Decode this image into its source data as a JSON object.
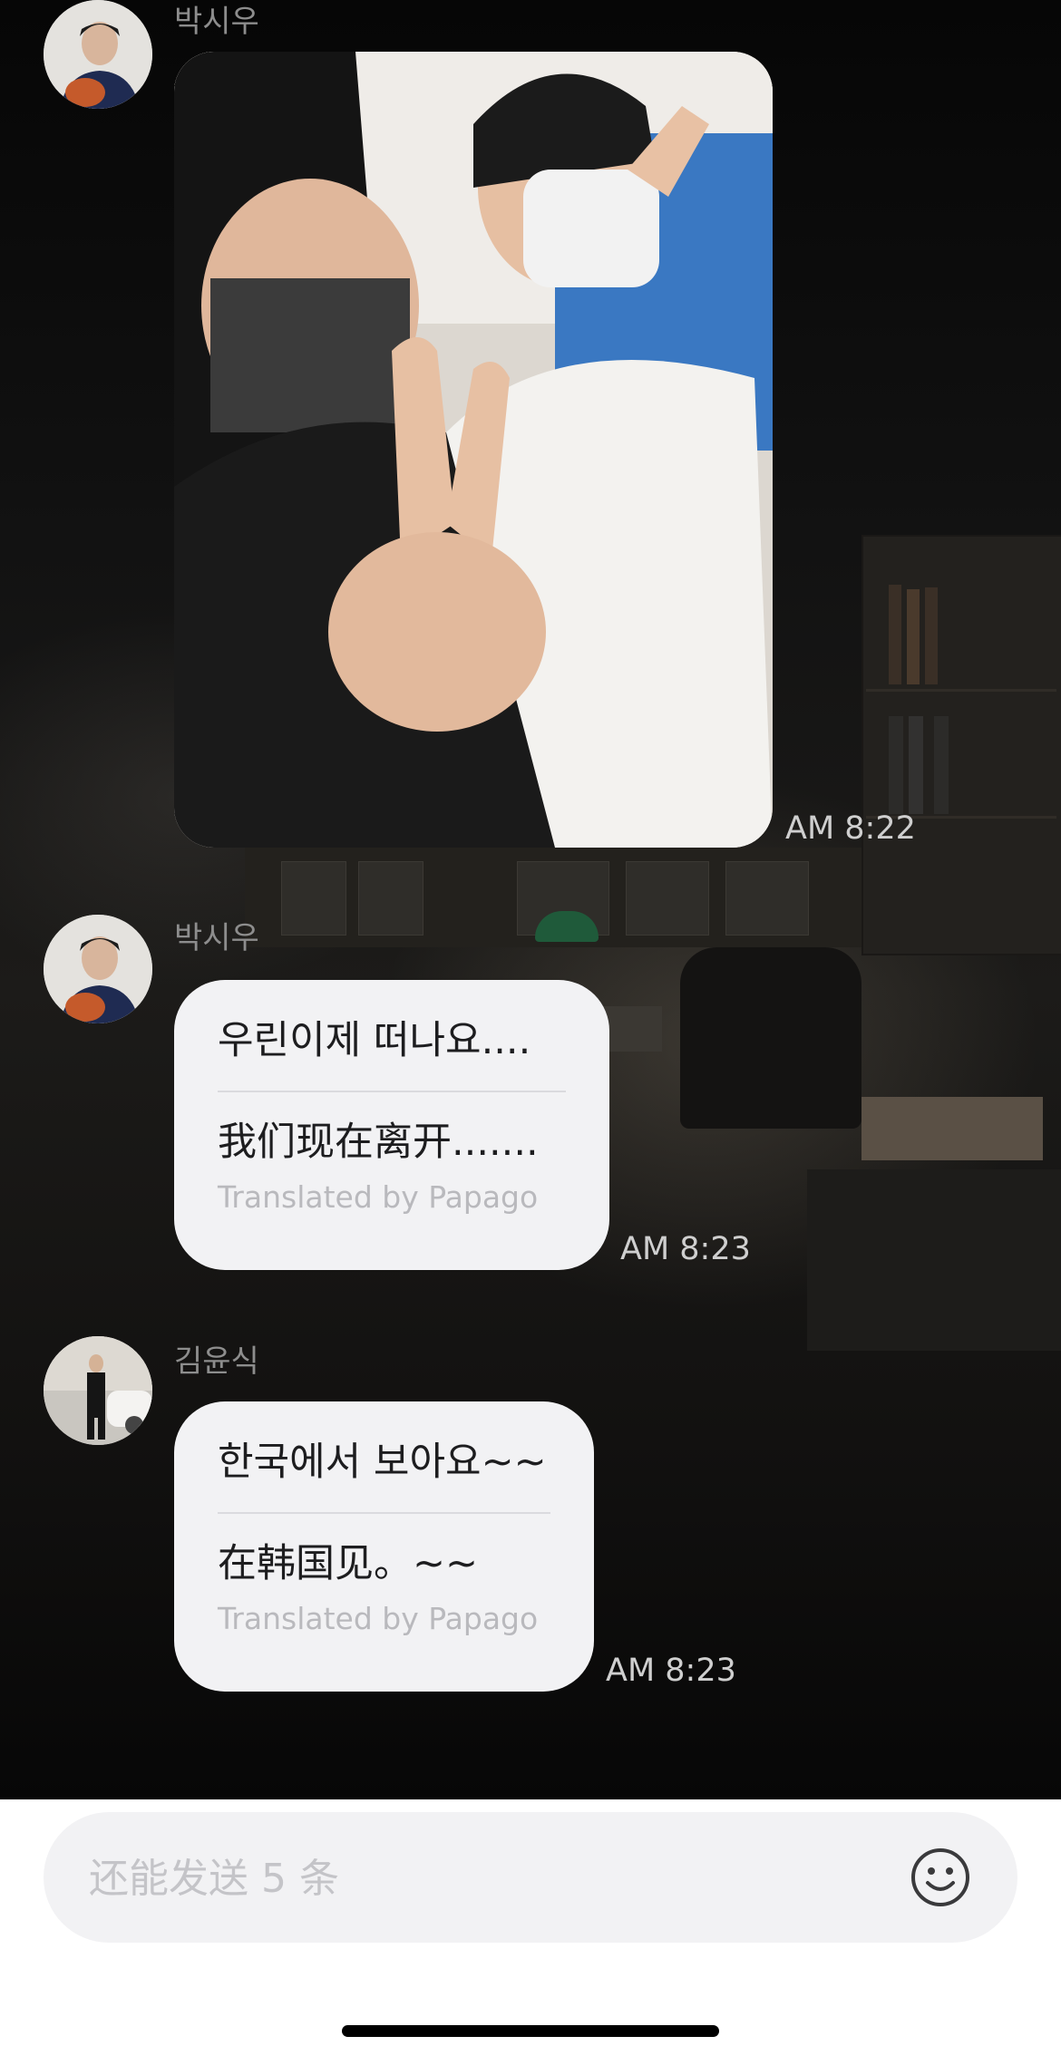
{
  "messages": [
    {
      "sender": "박시우",
      "type": "image",
      "time": "AM 8:22"
    },
    {
      "sender": "박시우",
      "type": "text",
      "original": "우린이제 떠나요....",
      "translation": "我们现在离开.......",
      "credit": "Translated by Papago",
      "time": "AM 8:23"
    },
    {
      "sender": "김윤식",
      "type": "text",
      "original": "한국에서 보아요~~",
      "translation": "在韩国见。~~",
      "credit": "Translated by Papago",
      "time": "AM 8:23"
    }
  ],
  "composer": {
    "placeholder": "还能发送 5 条",
    "emoji_icon": "smiley-face-icon"
  }
}
